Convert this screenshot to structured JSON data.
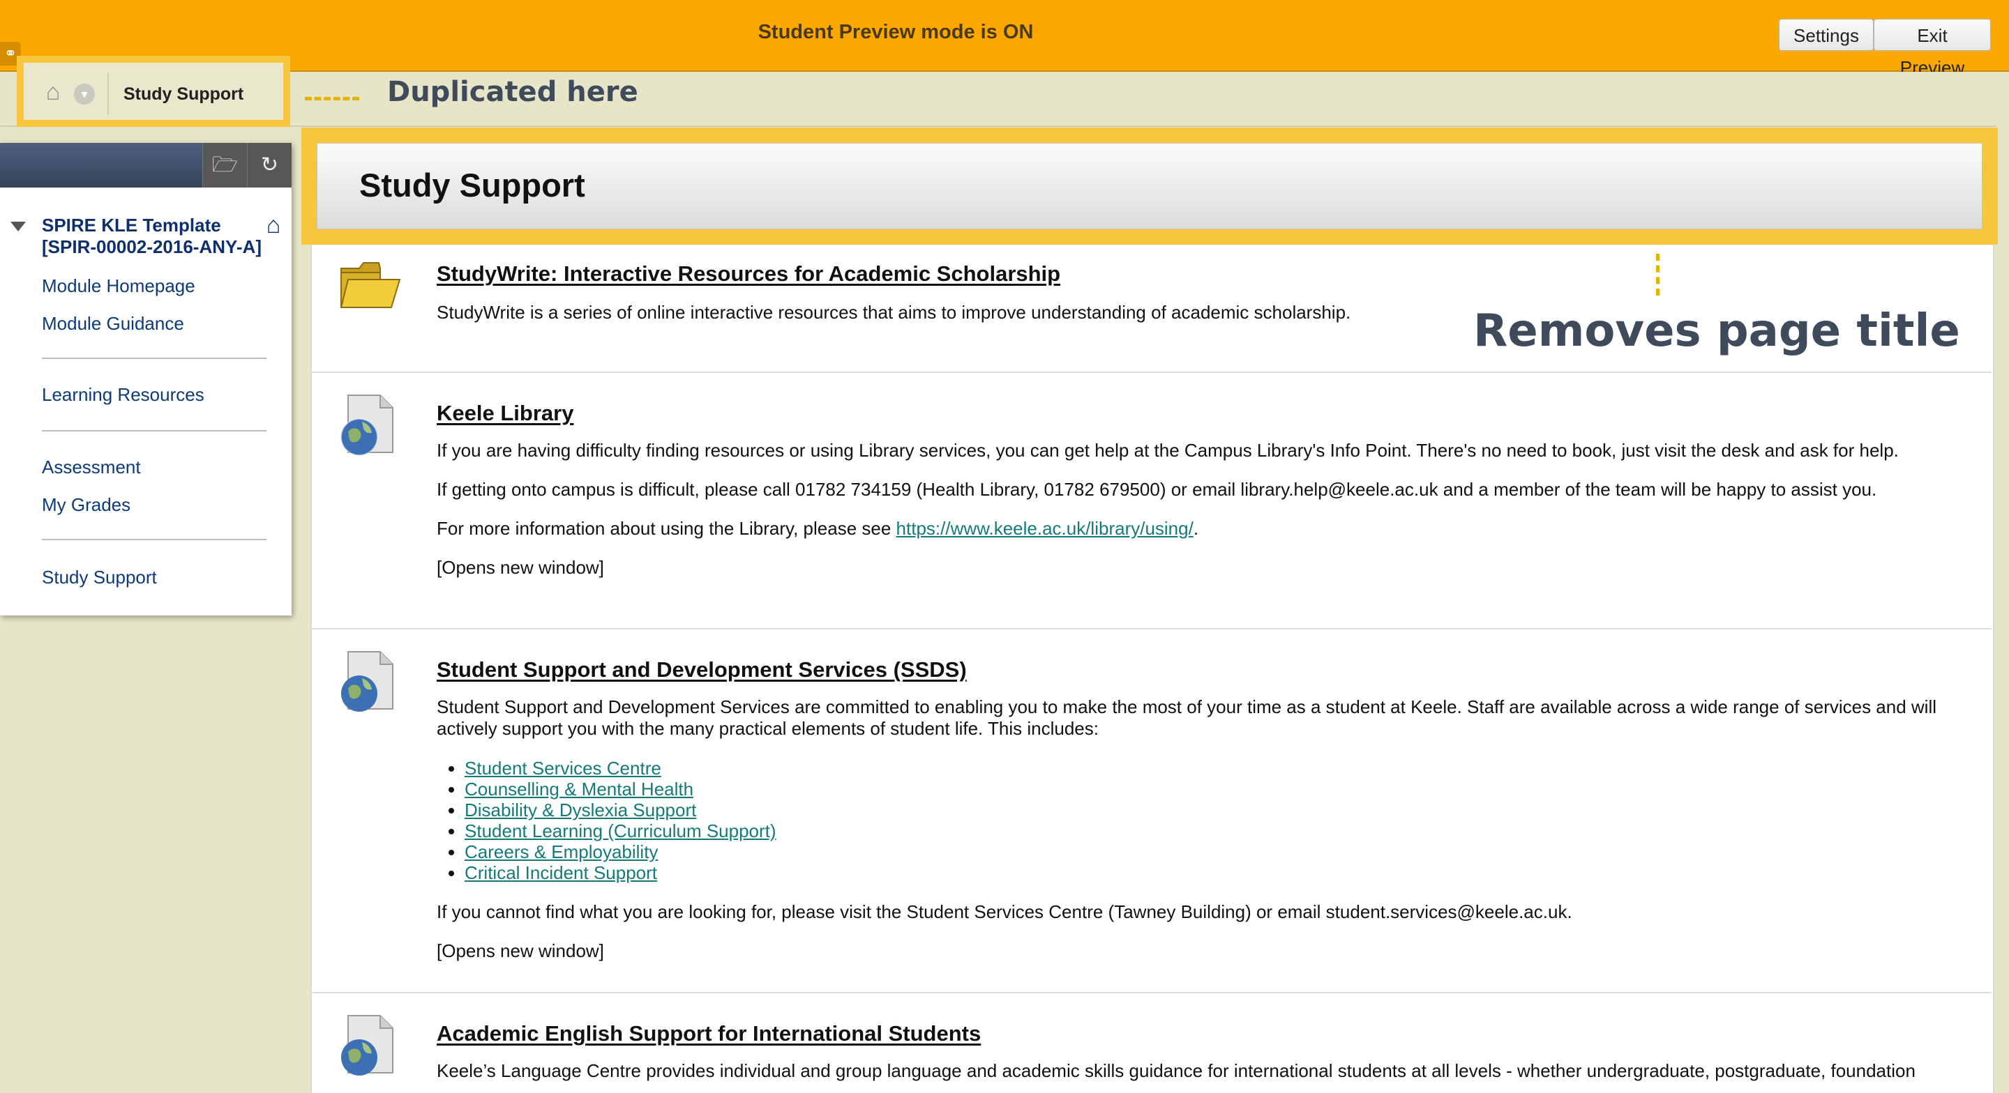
{
  "banner": {
    "title": "Student Preview mode is ON",
    "settings_label": "Settings",
    "exit_label": "Exit Preview"
  },
  "breadcrumb": {
    "current": "Study Support",
    "annotation": "Duplicated here"
  },
  "nav": {
    "course_title": "SPIRE KLE Template [SPIR-00002-2016-ANY-A]",
    "items": [
      "Module Homepage",
      "Module Guidance",
      "Learning Resources",
      "Assessment",
      "My Grades",
      "Study Support"
    ]
  },
  "page": {
    "title": "Study Support",
    "annotation": "Removes page title"
  },
  "content": [
    {
      "title": "StudyWrite: Interactive Resources for Academic Scholarship",
      "text1": "StudyWrite is a series of online interactive resources that aims to improve understanding of academic scholarship."
    },
    {
      "title": "Keele Library",
      "text1": "If you are having difficulty finding resources or using Library services, you can get help at the Campus Library's Info Point. There's no need to book, just visit the desk and ask for help.",
      "text2": "If getting onto campus is difficult, please call 01782 734159 (Health Library, 01782 679500) or email library.help@keele.ac.uk and a member of the team will be happy to assist you.",
      "text3_prefix": "For more information about using the Library, please see ",
      "text3_link": "https://www.keele.ac.uk/library/using/",
      "text3_suffix": ".",
      "opens": "[Opens new window]"
    },
    {
      "title": "Student Support and Development Services (SSDS)",
      "text1": "Student Support and Development Services are committed to enabling you to make the most of your time as a student at Keele. Staff are available across a wide range of services and will actively support you with the many practical elements of student life. This includes:",
      "links": [
        "Student Services Centre",
        "Counselling & Mental Health",
        "Disability & Dyslexia Support",
        "Student Learning (Curriculum Support)",
        "Careers & Employability",
        "Critical Incident Support"
      ],
      "text2": "If you cannot find what you are looking for, please visit the Student Services Centre (Tawney Building) or email student.services@keele.ac.uk.",
      "opens": "[Opens new window]"
    },
    {
      "title": "Academic English Support for International Students",
      "text1": "Keele’s Language Centre provides individual and group language and academic skills guidance for international students at all levels - whether undergraduate, postgraduate, foundation"
    }
  ],
  "icons": {
    "link": "link-icon",
    "home": "home-icon",
    "menu": "chevron-down-icon",
    "folder": "folder-icon",
    "refresh": "refresh-icon",
    "web_link": "globe-document-icon"
  },
  "colors": {
    "banner": "#fda800",
    "highlight": "#f7c63c",
    "nav_text": "#0d3a7a",
    "link": "#157a7a"
  }
}
